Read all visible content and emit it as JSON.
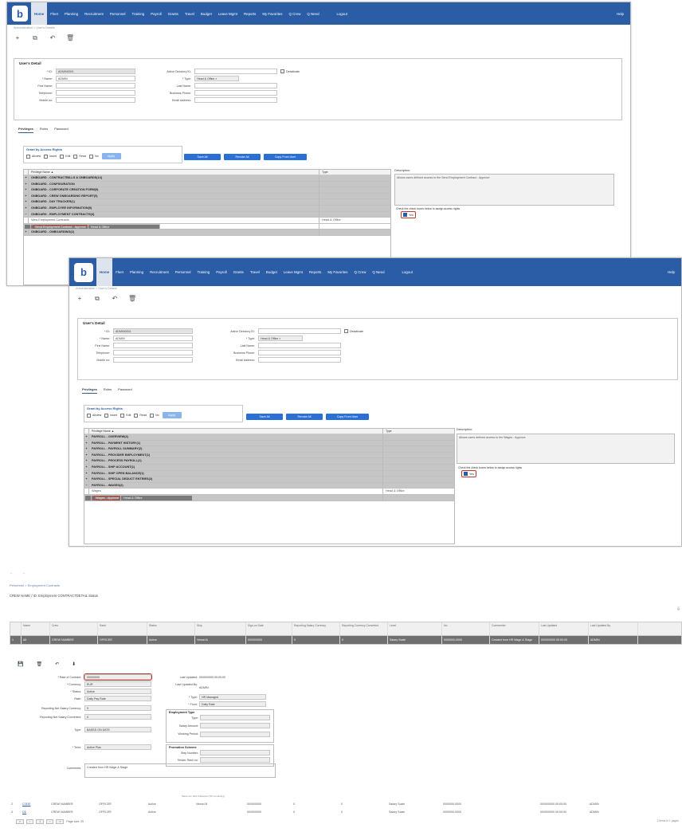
{
  "nav": {
    "items": [
      "Home",
      "Fleet",
      "Planning",
      "Recruitment",
      "Personnel",
      "Training",
      "Payroll",
      "Grants",
      "Travel",
      "Budget",
      "Leave Mgmt",
      "Reports",
      "My Favorites",
      "Q Crew",
      "Q Need"
    ],
    "logout": "Logout",
    "help": "Help"
  },
  "win1": {
    "breadcrumb": "Administration > User's Details",
    "section_title": "User's Detail",
    "fields": {
      "id_label": "* ID:",
      "id_value": "ADMIN0001",
      "name_label": "* Name:",
      "name_value": "ADMIN",
      "first_label": "First Name:",
      "phone_label": "Telephone:",
      "mobile_label": "Mobile no:",
      "ad_label": "Active Directory ID:",
      "type_label": "* Type:",
      "type_value": "Head & Office",
      "last_label": "Last Name:",
      "bphone_label": "Business Phone:",
      "email_label": "Email Address:",
      "deactivate_label": "Deactivate"
    },
    "tabs": [
      "Privileges",
      "Roles",
      "Password"
    ],
    "grant": {
      "title": "Grant by Access Rights",
      "options": [
        "Allview",
        "Insert",
        "Edit",
        "Read",
        "No"
      ],
      "button": "Apply"
    },
    "buttons": [
      "Save All",
      "Revoke All",
      "Copy From User"
    ],
    "grid_header": {
      "name": "Privilege Name ▲",
      "type": "Type"
    },
    "rows": [
      {
        "exp": "+",
        "name": "ONBOARD - CONTRACTBILLS & ONBOARDS(14)",
        "type": "",
        "kind": "group"
      },
      {
        "exp": "+",
        "name": "ONBOARD - CONFIGURATION",
        "type": "",
        "kind": "group"
      },
      {
        "exp": "+",
        "name": "ONBOARD - CORPORATE CREATION FORM(9)",
        "type": "",
        "kind": "group"
      },
      {
        "exp": "+",
        "name": "ONBOARD - CREW ONBOARDING REPORT(5)",
        "type": "",
        "kind": "group"
      },
      {
        "exp": "+",
        "name": "ONBOARD - DAY TRACKER(1)",
        "type": "",
        "kind": "group"
      },
      {
        "exp": "+",
        "name": "ONBOARD - EMPLOYEE INFORMATION(5)",
        "type": "",
        "kind": "group"
      },
      {
        "exp": "−",
        "name": "ONBOARD - EMPLOYMENT CONTRACTS(3)",
        "type": "",
        "kind": "group"
      },
      {
        "exp": "",
        "name": "View Employment Contracts",
        "type": "Head & Office",
        "kind": "sub"
      },
      {
        "exp": "",
        "name": "Send Employment Contract - Approve",
        "type": "Head & Office",
        "kind": "selected"
      },
      {
        "exp": "",
        "name": "Schedule Date",
        "type": "",
        "kind": "sub"
      },
      {
        "exp": "+",
        "name": "ONBOARD - ONBOARDING(2)",
        "type": "",
        "kind": "group"
      }
    ],
    "description_label": "Description:",
    "description": "Allows users defined access to the Send Employment Contract - Approve",
    "check_label": "Check the check boxes below to assign access rights",
    "check_value": "Yes"
  },
  "win2": {
    "breadcrumb": "Administration > User's Details",
    "section_title": "User's Detail",
    "fields": {
      "id_label": "* ID:",
      "id_value": "ADMIN0001",
      "name_label": "* Name:",
      "name_value": "ADMIN",
      "first_label": "First Name:",
      "phone_label": "Telephone:",
      "mobile_label": "Mobile no:",
      "ad_label": "Active Directory ID:",
      "type_label": "* Type:",
      "type_value": "Head & Office",
      "last_label": "Last Name:",
      "bphone_label": "Business Phone:",
      "email_label": "Email Address:",
      "deactivate_label": "Deactivate"
    },
    "tabs": [
      "Privileges",
      "Roles",
      "Password"
    ],
    "grant": {
      "title": "Grant by Access Rights",
      "options": [
        "Allview",
        "Insert",
        "Edit",
        "Read",
        "No"
      ],
      "button": "Apply"
    },
    "buttons": [
      "Save All",
      "Revoke All",
      "Copy From User"
    ],
    "grid_header": {
      "name": "Privilege Name ▲",
      "type": "Type"
    },
    "rows": [
      {
        "exp": "+",
        "name": "PAYROLL - OVERVIEW(4)",
        "type": "",
        "kind": "group"
      },
      {
        "exp": "+",
        "name": "PAYROLL - PAYMENT HISTORY(1)",
        "type": "",
        "kind": "group"
      },
      {
        "exp": "+",
        "name": "PAYROLL - PAYROLL SUMMARY(2)",
        "type": "",
        "kind": "group"
      },
      {
        "exp": "+",
        "name": "PAYROLL - PROVIDER EMPLOYMENT(1)",
        "type": "",
        "kind": "group"
      },
      {
        "exp": "+",
        "name": "PAYROLL - PROCESS PAYROLL(1)",
        "type": "",
        "kind": "group"
      },
      {
        "exp": "+",
        "name": "PAYROLL - SHIP ACCOUNT(1)",
        "type": "",
        "kind": "group"
      },
      {
        "exp": "+",
        "name": "PAYROLL - SHIP OPEN BALANCE(1)",
        "type": "",
        "kind": "group"
      },
      {
        "exp": "+",
        "name": "PAYROLL - SPECIAL DEDUCT ENTRIES(2)",
        "type": "",
        "kind": "group"
      },
      {
        "exp": "−",
        "name": "PAYROLL - WAGES(2)",
        "type": "",
        "kind": "group"
      },
      {
        "exp": "",
        "name": "Wages",
        "type": "Head & Office",
        "kind": "sub"
      },
      {
        "exp": "",
        "name": "Wages - Approve",
        "type": "Head & Office",
        "kind": "selected"
      },
      {
        "exp": "+",
        "name": "RECRUITMENT(14)",
        "type": "",
        "kind": "group"
      }
    ],
    "description_label": "Description:",
    "description": "Allows users defined access to the Wages - Approve",
    "check_label": "Check the check boxes below to assign access rights",
    "check_value": "Yes"
  },
  "win3": {
    "breadcrumb": "Personnel > Employment Contracts",
    "title": "CREW NAME / ID: Employment CONTRACTDETAIL Status",
    "columns": [
      "",
      "Name",
      "Crew",
      "Rank",
      "Status",
      "Ship",
      "Sign-on Date",
      "Reporting Salary Currency",
      "Reporting Currency Converted",
      "Level",
      "No.",
      "Commenter",
      "Last Updated",
      "Last Updated By"
    ],
    "row_selected": [
      "1",
      "Alt",
      "CREW NUMBER",
      "OFFICER",
      "Active",
      "Vessel A",
      "00/00/0000",
      "0",
      "0",
      "Salary Scale",
      "0000000-0000",
      "Created from HR Wage & Stage",
      "00/00/0000 00:00:00",
      "ADMIN"
    ],
    "form": {
      "labels": [
        "* Rate of Contract:",
        "* Currency:",
        "* Status:",
        "Rate:",
        "Reporting Net Salary Currency:",
        "Reporting Net Salary Converted:",
        "Type:",
        "* Term:",
        "Comments:"
      ],
      "values": [
        "00000000",
        "EUR",
        "Active",
        "Daily Pay Rate",
        "0",
        "0",
        "BASED ON DATE",
        "Active Plan",
        "Created from HR Wage & Stage"
      ],
      "right_labels": [
        "Last Updated:",
        "Last Updated By:",
        "* Type:",
        "* From:"
      ],
      "right_values": [
        "00/00/0000 00:00:00",
        "ADMIN",
        "HR Managed",
        "Daily Rate"
      ],
      "group1_title": "Employment Type",
      "group1_labels": [
        "Type:",
        "Salary Amount:",
        "Working Period:"
      ],
      "group2_title": "Promotion Scheme",
      "group2_labels": [
        "Step Number:",
        "Tender Rank no:"
      ],
      "counter": "Maximum 200 characters (50 remaining)"
    },
    "rows": [
      {
        "n": "2",
        "name": "CODE",
        "crew": "CREW NUMBER",
        "rank": "OFFICER",
        "status": "Active",
        "ship": "Vessel B",
        "date": "00/00/0000",
        "a": "0",
        "b": "0",
        "level": "Salary Scale",
        "no": "0000000-0000",
        "cm": "",
        "upd": "00/00/0000 00:00:00",
        "by": "ADMIN"
      },
      {
        "n": "3",
        "name": "DE",
        "crew": "CREW NUMBER",
        "rank": "OFFICER",
        "status": "Active",
        "ship": "",
        "date": "00/00/0000",
        "a": "0",
        "b": "0",
        "level": "Salary Scale",
        "no": "0000000-0000",
        "cm": "",
        "upd": "00/00/0000 00:00:00",
        "by": "ADMIN"
      }
    ],
    "pager": {
      "first": "«",
      "prev": "‹",
      "page": "1",
      "next": "›",
      "last": "»",
      "size": "Page size: 20",
      "info": "3 items in 1 pages"
    }
  }
}
